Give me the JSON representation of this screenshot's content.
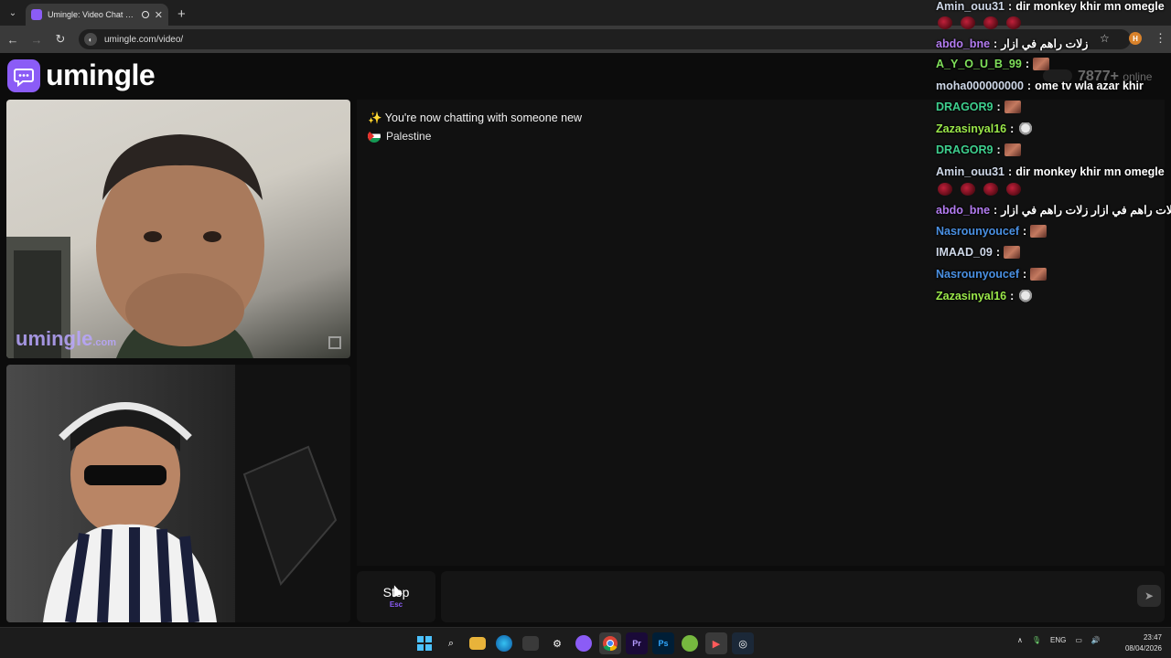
{
  "browser": {
    "tab_title": "Umingle: Video Chat with S",
    "url": "umingle.com/video/",
    "profile_initial": "H"
  },
  "site": {
    "logo_text": "umingle",
    "online_count": "7877+",
    "online_label": "online",
    "watermark": "umingle",
    "watermark_tld": ".com"
  },
  "chat": {
    "system_message": "✨ You're now chatting with someone new",
    "country": "Palestine",
    "stop_label": "Stop",
    "stop_key": "Esc",
    "input_placeholder": ""
  },
  "overlay_chat": [
    {
      "user": "Amin_ouu31",
      "color": "#cfd8e8",
      "text": "dir monkey khir mn omegle",
      "emote": null
    },
    {
      "user": "abdo_bne",
      "color": "#b37cf0",
      "text": "زلات راهم في ازار",
      "emote": null
    },
    {
      "user": "A_Y_O_U_B_99",
      "color": "#7fe05a",
      "text": "",
      "emote": "face"
    },
    {
      "user": "moha000000000",
      "color": "#cfd8e8",
      "text": "ome tv wla azar khir",
      "emote": null
    },
    {
      "user": "DRAGOR9",
      "color": "#3ecf8e",
      "text": "",
      "emote": "face"
    },
    {
      "user": "Zazasinyal16",
      "color": "#9be84a",
      "text": "",
      "emote": "cat"
    },
    {
      "user": "DRAGOR9",
      "color": "#3ecf8e",
      "text": "",
      "emote": "face"
    },
    {
      "user": "Amin_ouu31",
      "color": "#cfd8e8",
      "text": "dir monkey khir mn omegle",
      "emote": null
    },
    {
      "user": "abdo_bne",
      "color": "#b37cf0",
      "text": "زلات راهم في ازار زلات راهم في ازار",
      "emote": null
    },
    {
      "user": "Nasrounyoucef",
      "color": "#4a90e2",
      "text": "",
      "emote": "face"
    },
    {
      "user": "IMAAD_09",
      "color": "#cfd8e8",
      "text": "",
      "emote": "face"
    },
    {
      "user": "Nasrounyoucef",
      "color": "#4a90e2",
      "text": "",
      "emote": "face"
    },
    {
      "user": "Zazasinyal16",
      "color": "#9be84a",
      "text": "",
      "emote": "cat"
    }
  ],
  "taskbar": {
    "language": "ENG",
    "time": "23:47",
    "date": "08/04/2026"
  }
}
